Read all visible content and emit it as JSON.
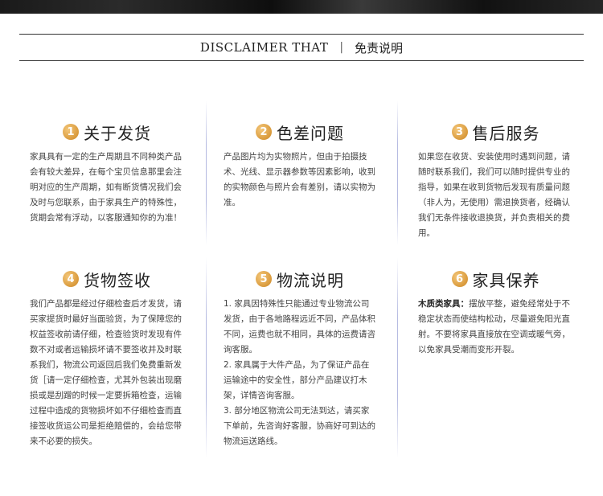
{
  "header": {
    "en": "DISCLAIMER THAT",
    "separator": "|",
    "zh": "免责说明"
  },
  "sections": [
    {
      "number": "1",
      "title": "关于发货",
      "body": "家具具有一定的生产周期且不同种类产品会有较大差异，在每个宝贝信息那里会注明对应的生产周期，如有断货情况我们会及时与您联系，由于家具生产的特殊性，货期会常有浮动，以客服通知你的为准！"
    },
    {
      "number": "2",
      "title": "色差问题",
      "body": "产品图片均为实物照片，但由于拍摄技术、光线、显示器参数等因素影响，收到的实物颜色与照片会有差别，请以实物为准。"
    },
    {
      "number": "3",
      "title": "售后服务",
      "body": "如果您在收货、安装使用时遇到问题，请随时联系我们，我们可以随时提供专业的指导，如果在收到货物后发现有质量问题（非人为，无使用）需退换货者，经确认我们无条件接收退换货，并负责相关的费用。"
    },
    {
      "number": "4",
      "title": "货物签收",
      "body": "我们产品都是经过仔细检查后才发货，请买家提货时最好当面验货，为了保障您的权益签收前请仔细，检查验货时发现有件数不对或者运输损坏请不要签收并及时联系我们，物流公司返回后我们免费重新发货［请一定仔细检查，尤其外包装出现磨损或是刮蹭的时候一定要拆箱检查，运输过程中造成的货物损坏如不仔细检查而直接签收货运公司是拒绝赔偿的，会给您带来不必要的损失。"
    },
    {
      "number": "5",
      "title": "物流说明",
      "items": [
        "1. 家具因特殊性只能通过专业物流公司发货，由于各地路程远近不同，产品体积不同，运费也就不相同，具体的运费请咨询客服。",
        "2. 家具属于大件产品，为了保证产品在运输途中的安全性，部分产品建议打木架，详情咨询客服。",
        "3. 部分地区物流公司无法到达，请买家下单前，先咨询好客服，协商好可到达的物流运送路线。"
      ]
    },
    {
      "number": "6",
      "title": "家具保养",
      "lead": "木质类家具：",
      "body": "摆放平整，避免经常处于不稳定状态而使结构松动，尽量避免阳光直射。不要将家具直接放在空调或暖气旁，以免家具受潮而变形开裂。"
    }
  ]
}
